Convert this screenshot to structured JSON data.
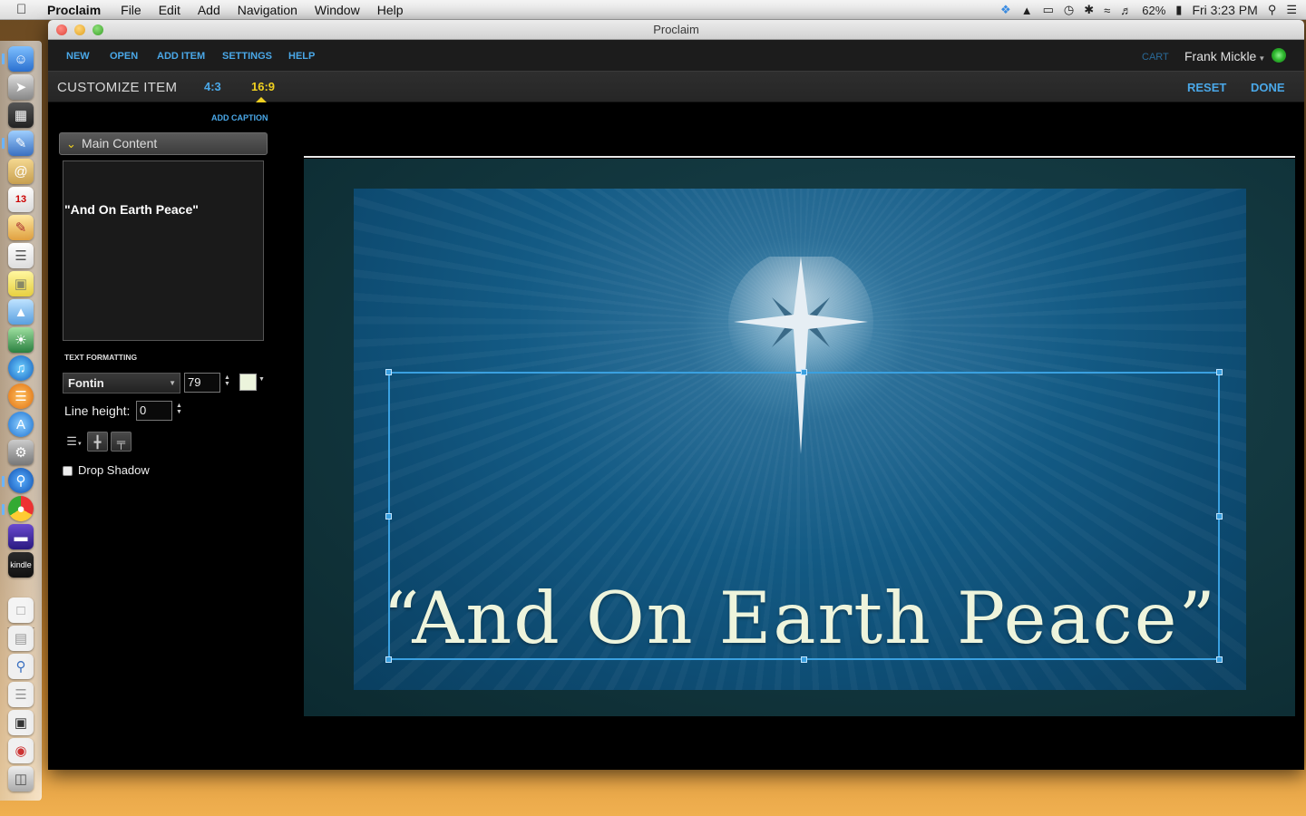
{
  "menubar": {
    "app": "Proclaim",
    "items": [
      "File",
      "Edit",
      "Add",
      "Navigation",
      "Window",
      "Help"
    ],
    "battery": "62%",
    "clock": "Fri 3:23 PM",
    "icons": [
      "apple-icon",
      "dropbox-icon",
      "drive-icon",
      "airplay-icon",
      "time-machine-icon",
      "bluetooth-icon",
      "wifi-icon",
      "volume-icon",
      "battery-icon",
      "spotlight-icon",
      "notification-center-icon"
    ]
  },
  "window": {
    "title": "Proclaim"
  },
  "toolbar": {
    "new": "NEW",
    "open": "OPEN",
    "add_item": "ADD ITEM",
    "settings": "SETTINGS",
    "help": "HELP",
    "cart": "CART",
    "user": "Frank Mickle",
    "status_color": "#2cb52c"
  },
  "subbar": {
    "heading": "CUSTOMIZE ITEM",
    "ratio_4_3": "4:3",
    "ratio_16_9": "16:9",
    "selected_ratio": "16:9",
    "reset": "RESET",
    "done": "DONE"
  },
  "panel": {
    "add_caption": "ADD CAPTION",
    "section": "Main Content",
    "text_value": "\"And On Earth Peace\"",
    "text_formatting": "TEXT FORMATTING",
    "font": "Fontin",
    "font_size": "79",
    "text_color": "#ecf4dc",
    "line_height_label": "Line height:",
    "line_height": "0",
    "drop_shadow": "Drop Shadow",
    "drop_shadow_checked": false
  },
  "slide": {
    "text": "“And On Earth Peace”",
    "accent": "#3aa0e0"
  },
  "colors": {
    "accent_blue": "#4aa8e8",
    "highlight_yellow": "#f0d020"
  }
}
